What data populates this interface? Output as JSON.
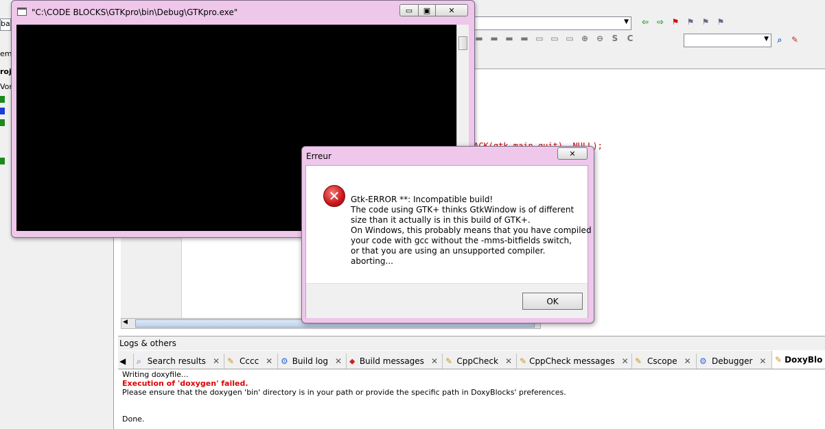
{
  "console_window": {
    "title": "\"C:\\CODE BLOCKS\\GTKpro\\bin\\Debug\\GTKpro.exe\"",
    "minimize_glyph": "▭",
    "maximize_glyph": "▣",
    "close_glyph": "✕"
  },
  "dialog": {
    "title": "Erreur",
    "close_glyph": "✕",
    "message_lines": [
      "Gtk-ERROR **: Incompatible build!",
      "The code using GTK+ thinks GtkWindow is of different",
      "size than it actually is in this build of GTK+.",
      "On Windows, this probably means that you have compiled",
      "your code with gcc without the -mms-bitfields switch,",
      "or that you are using an unsupported compiler.",
      "aborting..."
    ],
    "ok_label": "OK"
  },
  "editor": {
    "visible_code_fragment": "ACK(gtk_main_quit), NULL);"
  },
  "left_panel": {
    "fragments": [
      "bal",
      "em",
      "roj",
      "Vor"
    ]
  },
  "logs": {
    "header": "Logs & others",
    "tabs": [
      {
        "label": "Search results",
        "icon": "search-icon"
      },
      {
        "label": "Cccc",
        "icon": "pencil-doc-icon"
      },
      {
        "label": "Build log",
        "icon": "gear-icon"
      },
      {
        "label": "Build messages",
        "icon": "build-messages-icon"
      },
      {
        "label": "CppCheck",
        "icon": "pencil-doc-icon"
      },
      {
        "label": "CppCheck messages",
        "icon": "pencil-doc-icon"
      },
      {
        "label": "Cscope",
        "icon": "pencil-doc-icon"
      },
      {
        "label": "Debugger",
        "icon": "gear-icon"
      },
      {
        "label": "DoxyBlo",
        "icon": "pencil-doc-icon"
      }
    ],
    "lines": [
      {
        "text": "Writing doxyfile...",
        "style": "normal"
      },
      {
        "text": "Execution of 'doxygen' failed.",
        "style": "error"
      },
      {
        "text": "Please ensure that the doxygen 'bin' directory is in your path or provide the specific path in DoxyBlocks' preferences.",
        "style": "normal"
      },
      {
        "text": "",
        "style": "normal"
      },
      {
        "text": "",
        "style": "normal"
      },
      {
        "text": "Done.",
        "style": "normal"
      }
    ]
  },
  "colors": {
    "window_frame": "#eec7ea",
    "error_text": "#e00000",
    "code_red": "#cc0000"
  }
}
